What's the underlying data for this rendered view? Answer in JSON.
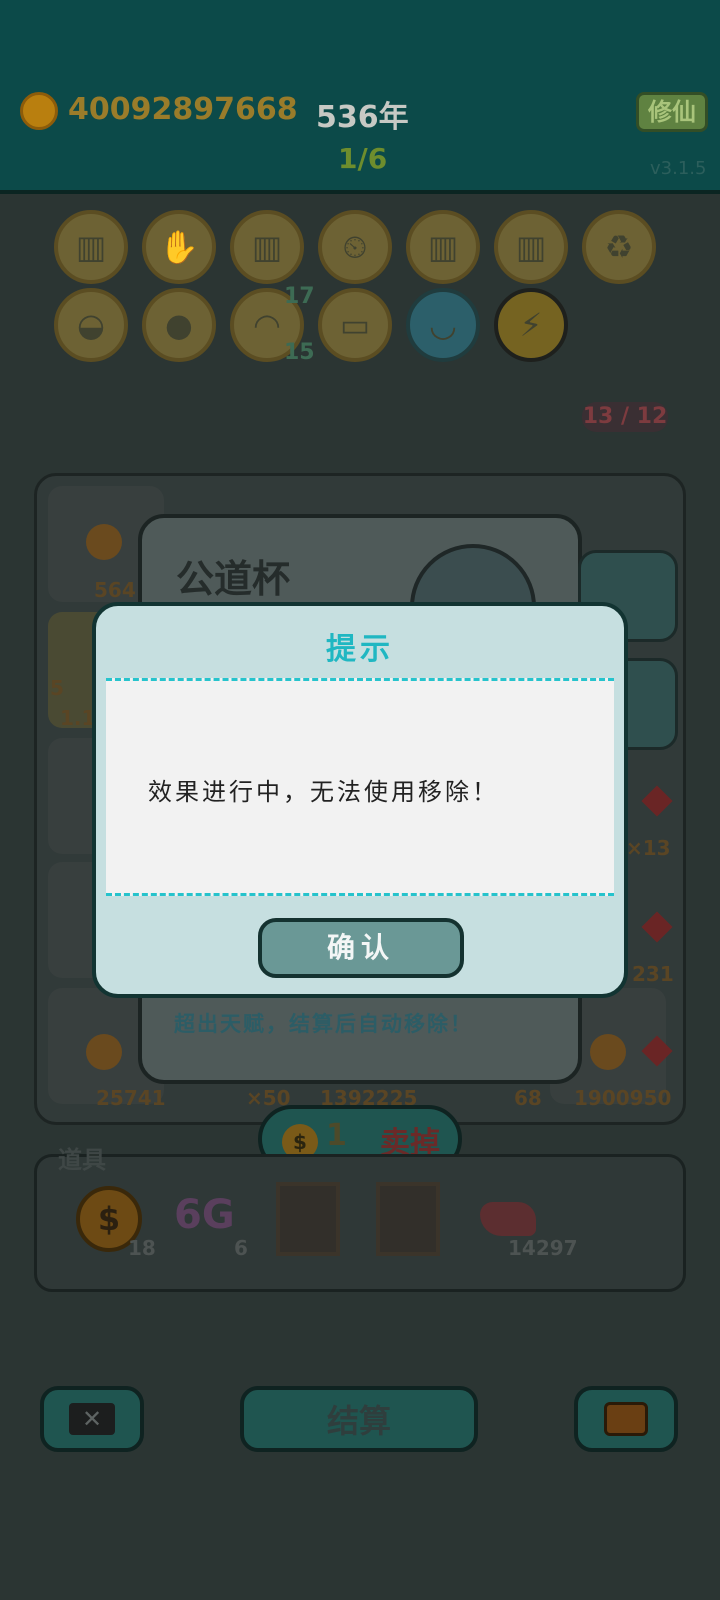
{
  "header": {
    "coins": "40092897668",
    "years": "536年",
    "progress": "1/6",
    "cultivate_label": "修仙",
    "version": "v3.1.5"
  },
  "badges": {
    "row2_counts": [
      "17",
      "15"
    ],
    "sell_count": "13 / 12"
  },
  "board": {
    "numbers": [
      "564",
      "5",
      "1.1",
      "×13",
      "231",
      "25741",
      "×50",
      "1392225",
      "68",
      "1900950"
    ]
  },
  "item_card": {
    "title": "公道杯",
    "description": "超出天赋，结算后自动移除！"
  },
  "sell": {
    "price": "1",
    "label": "卖掉"
  },
  "tools": {
    "label": "道具",
    "items": [
      {
        "icon": "dollar-coin-icon",
        "count": "18"
      },
      {
        "icon": "6g-icon",
        "text": "6G",
        "count": "6"
      },
      {
        "icon": "empty-slot",
        "count": ""
      },
      {
        "icon": "empty-slot",
        "count": ""
      },
      {
        "icon": "liver-icon",
        "count": "14297"
      }
    ]
  },
  "bottom": {
    "settle_label": "结算"
  },
  "dialog": {
    "title": "提示",
    "message": "效果进行中，无法使用移除！",
    "confirm_label": "确认"
  },
  "colors": {
    "dialog_title": "#20b7c2",
    "dialog_bg": "#c6dfe0",
    "dim_overlay": "#26312f"
  }
}
